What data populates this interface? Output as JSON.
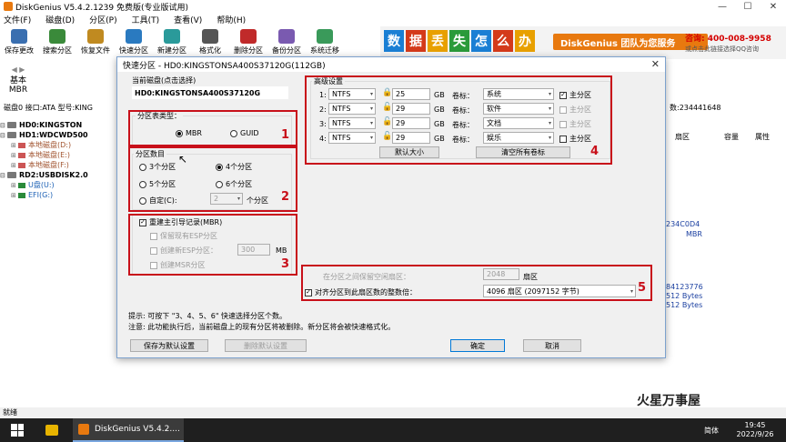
{
  "window": {
    "title": "DiskGenius V5.4.2.1239 免费版(专业版试用)",
    "controls": [
      "—",
      "☐",
      "✕"
    ]
  },
  "menu": [
    "文件(F)",
    "磁盘(D)",
    "分区(P)",
    "工具(T)",
    "查看(V)",
    "帮助(H)"
  ],
  "toolbar": [
    {
      "label": "保存更改",
      "color": "#3a6fb0"
    },
    {
      "label": "搜索分区",
      "color": "#3a8a3a"
    },
    {
      "label": "恢复文件",
      "color": "#c08a20"
    },
    {
      "label": "快速分区",
      "color": "#2a7ac0"
    },
    {
      "label": "新建分区",
      "color": "#2a9a9a"
    },
    {
      "label": "格式化",
      "color": "#555555"
    },
    {
      "label": "删除分区",
      "color": "#c02a2a"
    },
    {
      "label": "备份分区",
      "color": "#7a5ab0"
    },
    {
      "label": "系统迁移",
      "color": "#3a9a5a"
    }
  ],
  "banner": {
    "tiles": [
      "数",
      "据",
      "丢",
      "失",
      "怎",
      "么",
      "办"
    ],
    "tile_colors": [
      "#1a7fd4",
      "#d43a1a",
      "#e8a000",
      "#2a9a3a",
      "#1a7fd4",
      "#d43a1a",
      "#e8a000"
    ],
    "brand": "DiskGenius 团队为您服务",
    "phone": "咨询: 400-008-9958",
    "qq": "或点击此链接选择QQ咨询"
  },
  "leftnav": {
    "line1": "基本",
    "line2": "MBR"
  },
  "diskinfo": {
    "left": "磁盘0 接口:ATA  型号:KING",
    "right": "数:234441648"
  },
  "tree": [
    {
      "text": "HD0:KINGSTON",
      "type": "disk"
    },
    {
      "text": "HD1:WDCWD500",
      "type": "disk"
    },
    {
      "text": "本地磁盘(D:)",
      "type": "vol"
    },
    {
      "text": "本地磁盘(E:)",
      "type": "vol"
    },
    {
      "text": "本地磁盘(F:)",
      "type": "vol"
    },
    {
      "text": "RD2:USBDISK2.0",
      "type": "disk"
    },
    {
      "text": "U盘(U:)",
      "type": "uvol"
    },
    {
      "text": "EFI(G:)",
      "type": "uvol"
    }
  ],
  "rightcols": {
    "sector": "扇区",
    "capacity": "容量",
    "attr": "属性"
  },
  "rightinfo": [
    "234C0D4",
    "MBR",
    "84123776",
    "512 Bytes",
    "512 Bytes"
  ],
  "statusbar": "就绪",
  "watermark": "火星万事屋",
  "taskbar": {
    "app": "DiskGenius V5.4.2....",
    "lang": "简体",
    "time": "19:45",
    "date": "2022/9/26"
  },
  "dialog": {
    "title": "快速分区 - HD0:KINGSTONSA400S37120G(112GB)",
    "current_disk_label": "当前磁盘(点击选择)",
    "current_disk_value": "HD0:KINGSTONSA400S37120G",
    "partition_table": {
      "title": "分区表类型：",
      "options": [
        "MBR",
        "GUID"
      ],
      "selected": "MBR"
    },
    "partition_count": {
      "title": "分区数目",
      "options": [
        "3个分区",
        "4个分区",
        "5个分区",
        "6个分区"
      ],
      "selected": "4个分区",
      "custom_label": "自定(C):",
      "custom_value": "2",
      "custom_suffix": "个分区"
    },
    "mbr": {
      "rebuild_label": "重建主引导记录(MBR)",
      "keep_esp": "保留现有ESP分区",
      "create_esp": "创建新ESP分区：",
      "esp_size": "300",
      "esp_unit": "MB",
      "create_msr": "创建MSR分区"
    },
    "advanced": {
      "title": "高级设置",
      "rows": [
        {
          "idx": "1:",
          "fs": "NTFS",
          "size": "25",
          "unit": "GB",
          "vol_label_title": "卷标：",
          "label": "系统",
          "primary": "主分区",
          "primary_checked": true
        },
        {
          "idx": "2:",
          "fs": "NTFS",
          "size": "29",
          "unit": "GB",
          "vol_label_title": "卷标：",
          "label": "软件",
          "primary": "主分区",
          "primary_checked": false
        },
        {
          "idx": "3:",
          "fs": "NTFS",
          "size": "29",
          "unit": "GB",
          "vol_label_title": "卷标：",
          "label": "文档",
          "primary": "主分区",
          "primary_checked": false
        },
        {
          "idx": "4:",
          "fs": "NTFS",
          "size": "29",
          "unit": "GB",
          "vol_label_title": "卷标：",
          "label": "娱乐",
          "primary": "主分区",
          "primary_checked": false
        }
      ],
      "default_size": "默认大小",
      "clear_labels": "清空所有卷标"
    },
    "reserve": {
      "label": "在分区之间保留空闲扇区：",
      "value": "2048",
      "unit": "扇区"
    },
    "align": {
      "label": "对齐分区到此扇区数的整数倍：",
      "value": "4096 扇区 (2097152 字节)"
    },
    "tip": "提示: 可按下 \"3、4、5、6\" 快速选择分区个数。",
    "notice": "注意: 此功能执行后，当前磁盘上的现有分区将被删除。新分区将会被快速格式化。",
    "buttons": {
      "save_default": "保存为默认设置",
      "delete_default": "删除默认设置",
      "ok": "确定",
      "cancel": "取消"
    },
    "annotations": [
      "1",
      "2",
      "3",
      "4",
      "5"
    ]
  }
}
